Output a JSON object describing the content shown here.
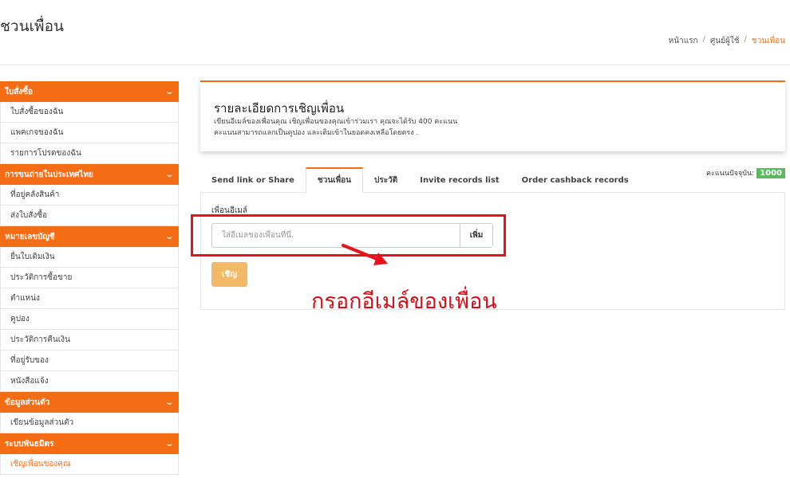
{
  "header": {
    "page_title": "ชวนเพื่อน",
    "breadcrumb": [
      "หน้าแรก",
      "ศูนย์ผู้ใช้",
      "ชวนเพื่อน"
    ]
  },
  "sidebar": {
    "sections": [
      {
        "title": "ใบสั่งซื้อ",
        "items": [
          "ใบสั่งซื้อของฉัน",
          "แพคเกจของฉัน",
          "รายการโปรดของฉัน"
        ]
      },
      {
        "title": "การขนถ่ายในประเทศไทย",
        "items": [
          "ที่อยู่คลังสินค้า",
          "ส่งใบสั่งซื้อ"
        ]
      },
      {
        "title": "หมายเลขบัญชี",
        "items": [
          "ยื่นใบเติมเงิน",
          "ประวัติการซื้อขาย",
          "ตำแหน่ง",
          "คูปอง",
          "ประวัติการคืนเงิน",
          "ที่อยู่รับของ",
          "หนังสือแจ้ง"
        ]
      },
      {
        "title": "ข้อมูลส่วนตัว",
        "items": [
          "เขียนข้อมูลส่วนตัว"
        ]
      },
      {
        "title": "ระบบพันธมิตร",
        "items": [
          "เชิญเพื่อนของคุณ"
        ]
      }
    ],
    "active_item": "เชิญเพื่อนของคุณ"
  },
  "invite_card": {
    "title": "รายละเอียดการเชิญเพื่อน",
    "desc_line1": "เขียนอีเมล์ของเพื่อนคุณ เชิญเพื่อนของคุณเข้าร่วมเรา คุณจะได้รับ 400 คะแนน",
    "desc_line2": "คะแนนสามารถแลกเป็นคูปอง และเติมเข้าในยอดคงเหลือโดยตรง ."
  },
  "points": {
    "label": "คะแนนปัจจุบัน:",
    "value": "1000",
    "badge_color": "#5cb85c"
  },
  "tabs": [
    {
      "label": "Send link or Share",
      "active": false
    },
    {
      "label": "ชวนเพื่อน",
      "active": true
    },
    {
      "label": "ประวัติ",
      "active": false
    },
    {
      "label": "Invite records list",
      "active": false
    },
    {
      "label": "Order cashback records",
      "active": false
    }
  ],
  "form": {
    "field_label": "เพื่อนอีเมล์",
    "email_placeholder": "ใส่อีเมลของเพื่อนที่นี่.",
    "email_value": "",
    "add_label": "เพิ่ม",
    "invite_label": "เชิญ"
  },
  "annotation": {
    "text": "กรอกอีเมล์ของเพื่อน",
    "color": "#d4101a"
  },
  "colors": {
    "accent": "#f46c13",
    "button": "#f0ad4e",
    "highlight": "#e8111e"
  }
}
